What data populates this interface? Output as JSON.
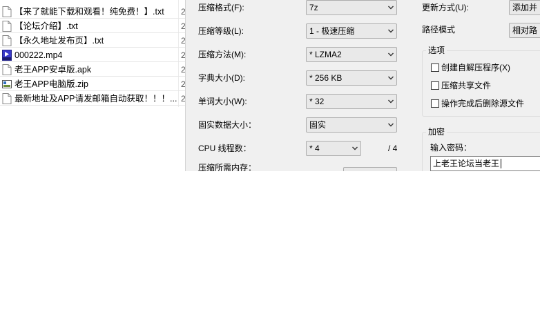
{
  "files": [
    {
      "name": "【来了就能下载和观看！纯免费！】.txt",
      "col2": "2",
      "icon": "text-file-icon"
    },
    {
      "name": "【论坛介绍】.txt",
      "col2": "2",
      "icon": "text-file-icon"
    },
    {
      "name": "【永久地址发布页】.txt",
      "col2": "2",
      "icon": "text-file-icon"
    },
    {
      "name": "000222.mp4",
      "col2": "2",
      "icon": "mp4-file-icon"
    },
    {
      "name": "老王APP安卓版.apk",
      "col2": "2",
      "icon": "generic-file-icon"
    },
    {
      "name": "老王APP电脑版.zip",
      "col2": "2",
      "icon": "zip-file-icon"
    },
    {
      "name": "最新地址及APP请发邮箱自动获取！！！....",
      "col2": "2",
      "icon": "text-file-icon"
    }
  ],
  "archive_format": {
    "label": "压缩格式(F):",
    "value": "7z"
  },
  "compression_level": {
    "label": "压缩等级(L):",
    "value": "1 - 极速压缩"
  },
  "compression_method": {
    "label": "压缩方法(M):",
    "value": "* LZMA2"
  },
  "dictionary_size": {
    "label": "字典大小(D):",
    "value": "* 256 KB"
  },
  "word_size": {
    "label": "单词大小(W):",
    "value": "* 32"
  },
  "solid_block": {
    "label": "固实数据大小：",
    "value": "固实"
  },
  "cpu_threads": {
    "label": "CPU 线程数：",
    "value": "* 4",
    "total": "/ 4"
  },
  "memory_label": "压缩所需内存：",
  "update_mode": {
    "label": "更新方式(U):",
    "value": "添加并"
  },
  "path_mode": {
    "label": "路径模式",
    "value": "相对路"
  },
  "options": {
    "title": "选项",
    "items": [
      {
        "label": "创建自解压程序(X)",
        "checked": false
      },
      {
        "label": "压缩共享文件",
        "checked": false
      },
      {
        "label": "操作完成后删除源文件",
        "checked": false
      }
    ]
  },
  "encryption": {
    "title": "加密",
    "password_label": "输入密码：",
    "password_value": "上老王论坛当老王"
  },
  "colors": {
    "dialog_bg": "#f0f0f0",
    "combo_bg": "#e9e9e9",
    "border": "#adadad"
  }
}
